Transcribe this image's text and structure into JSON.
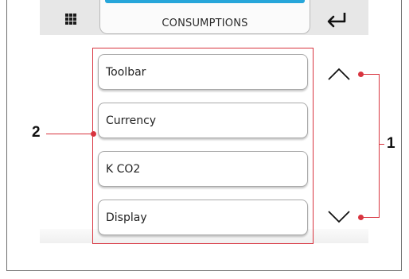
{
  "header": {
    "title": "CONSUMPTIONS",
    "menu_icon": "grid-menu-icon",
    "back_icon": "return-arrow-icon"
  },
  "list": {
    "items": [
      {
        "label": "Toolbar"
      },
      {
        "label": "Currency"
      },
      {
        "label": "K CO2"
      },
      {
        "label": "Display"
      }
    ]
  },
  "scroll": {
    "up_icon": "chevron-up-icon",
    "down_icon": "chevron-down-icon"
  },
  "callouts": {
    "list_number": "2",
    "arrows_number": "1"
  },
  "colors": {
    "accent": "#27a6da",
    "callout": "#d8343f",
    "topbar": "#e7e7e7"
  }
}
